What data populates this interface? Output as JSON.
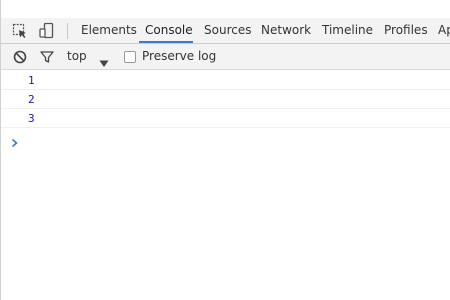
{
  "toolbar_top": {
    "icons": [
      "inspect-element-icon",
      "device-mode-icon"
    ]
  },
  "tabs": [
    {
      "label": "Elements",
      "active": false
    },
    {
      "label": "Console",
      "active": true
    },
    {
      "label": "Sources",
      "active": false
    },
    {
      "label": "Network",
      "active": false
    },
    {
      "label": "Timeline",
      "active": false
    },
    {
      "label": "Profiles",
      "active": false
    },
    {
      "label": "Ap",
      "active": false
    }
  ],
  "console_toolbar": {
    "icons": [
      "clear-console-icon",
      "filter-icon"
    ],
    "context": "top",
    "preserve_log_label": "Preserve log",
    "preserve_log_checked": false
  },
  "console": {
    "messages": [
      "1",
      "2",
      "3"
    ],
    "prompt_symbol": "›"
  },
  "colors": {
    "accent": "#3879d9",
    "log_text": "#1a1aa6",
    "toolbar_bg": "#f3f3f3"
  }
}
